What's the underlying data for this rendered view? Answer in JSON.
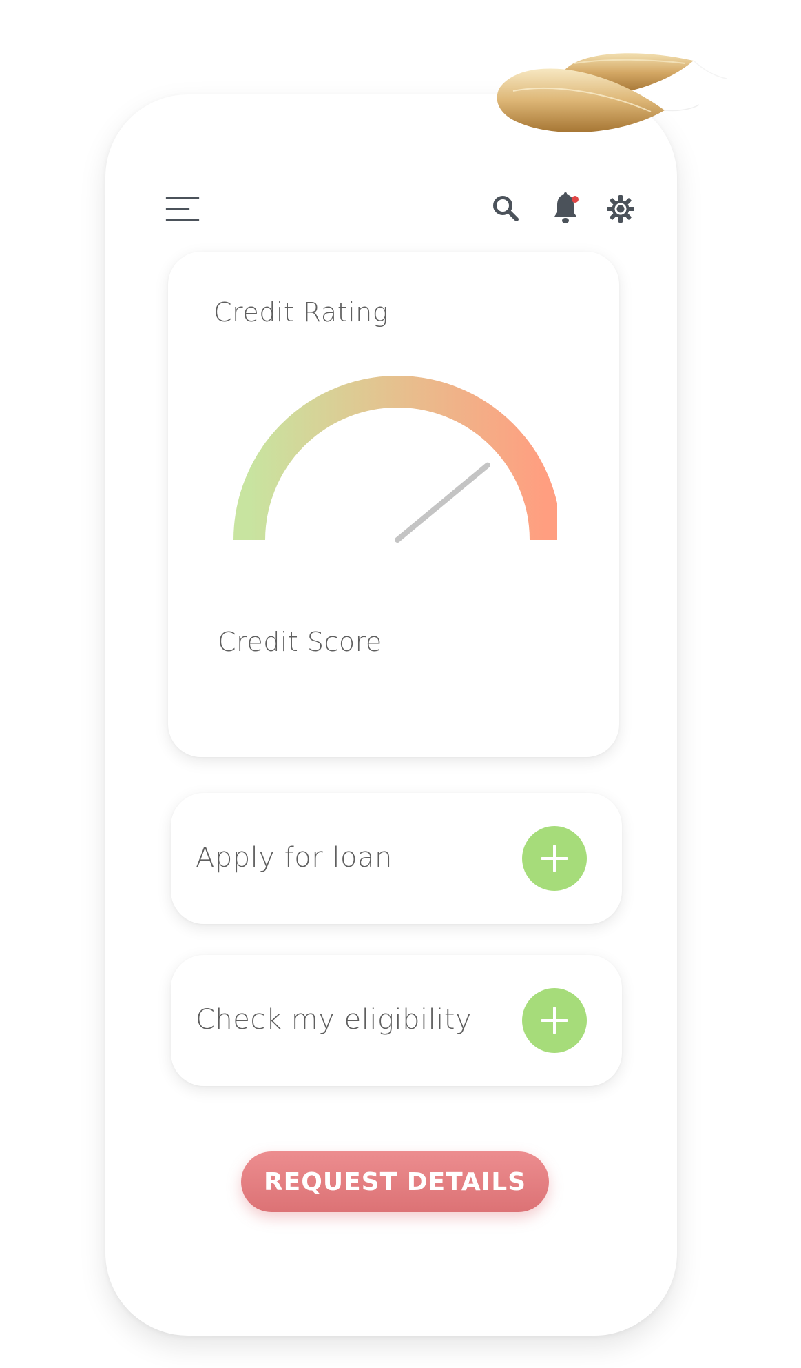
{
  "credit_card": {
    "title": "Credit Rating",
    "score_label": "Credit Score",
    "gauge_level": 0.78
  },
  "actions": [
    {
      "label": "Apply for loan",
      "button_icon": "plus-icon"
    },
    {
      "label": "Check my eligibility",
      "button_icon": "plus-icon"
    }
  ],
  "request_button": {
    "label": "REQUEST DETAILS"
  },
  "header": {
    "icons": [
      "menu-icon",
      "search-icon",
      "bell-icon",
      "gear-icon"
    ],
    "notification_dot": true
  },
  "colors": {
    "accent_green": "#a6dc7a",
    "gauge_start": "#c8e4a0",
    "gauge_mid": "#e6c08e",
    "gauge_end": "#ff9e80",
    "request_button": "#e07d80",
    "text": "#5f5f5f",
    "icon": "#4b525a",
    "notification": "#e04545"
  }
}
